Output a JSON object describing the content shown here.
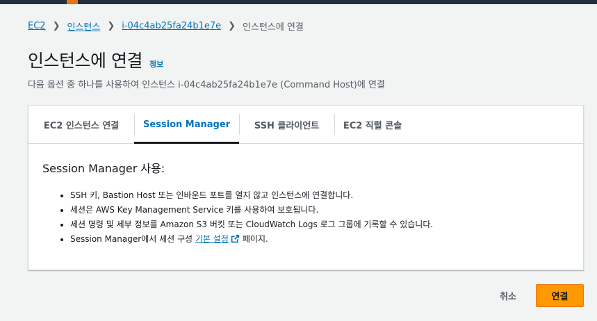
{
  "colors": {
    "accent": "#ff9900",
    "link": "#0073bb",
    "header": "#232f3e"
  },
  "breadcrumb": {
    "items": [
      "EC2",
      "인스턴스",
      "i-04c4ab25fa24b1e7e"
    ],
    "current": "인스턴스에 연결",
    "separator_icon": "chevron-right-icon"
  },
  "header": {
    "title": "인스턴스에 연결",
    "info_label": "정보",
    "description": "다음 옵션 중 하나를 사용하여 인스턴스 i-04c4ab25fa24b1e7e (Command Host)에 연결"
  },
  "tabs": [
    {
      "label": "EC2 인스턴스 연결",
      "active": false
    },
    {
      "label": "Session Manager",
      "active": true
    },
    {
      "label": "SSH 클라이언트",
      "active": false
    },
    {
      "label": "EC2 직렬 콘솔",
      "active": false
    }
  ],
  "session_manager": {
    "heading": "Session Manager 사용:",
    "bullets": [
      "SSH 키, Bastion Host 또는 인바운드 포트를 열지 않고 인스턴스에 연결합니다.",
      "세션은 AWS Key Management Service 키를 사용하여 보호됩니다.",
      "세션 명령 및 세부 정보를 Amazon S3 버킷 또는 CloudWatch Logs 로그 그룹에 기록할 수 있습니다."
    ],
    "last_bullet": {
      "prefix": "Session Manager에서 세션 구성",
      "link": "기본 설정",
      "link_icon": "external-link-icon",
      "suffix": "페이지."
    }
  },
  "footer": {
    "cancel_label": "취소",
    "connect_label": "연결"
  }
}
